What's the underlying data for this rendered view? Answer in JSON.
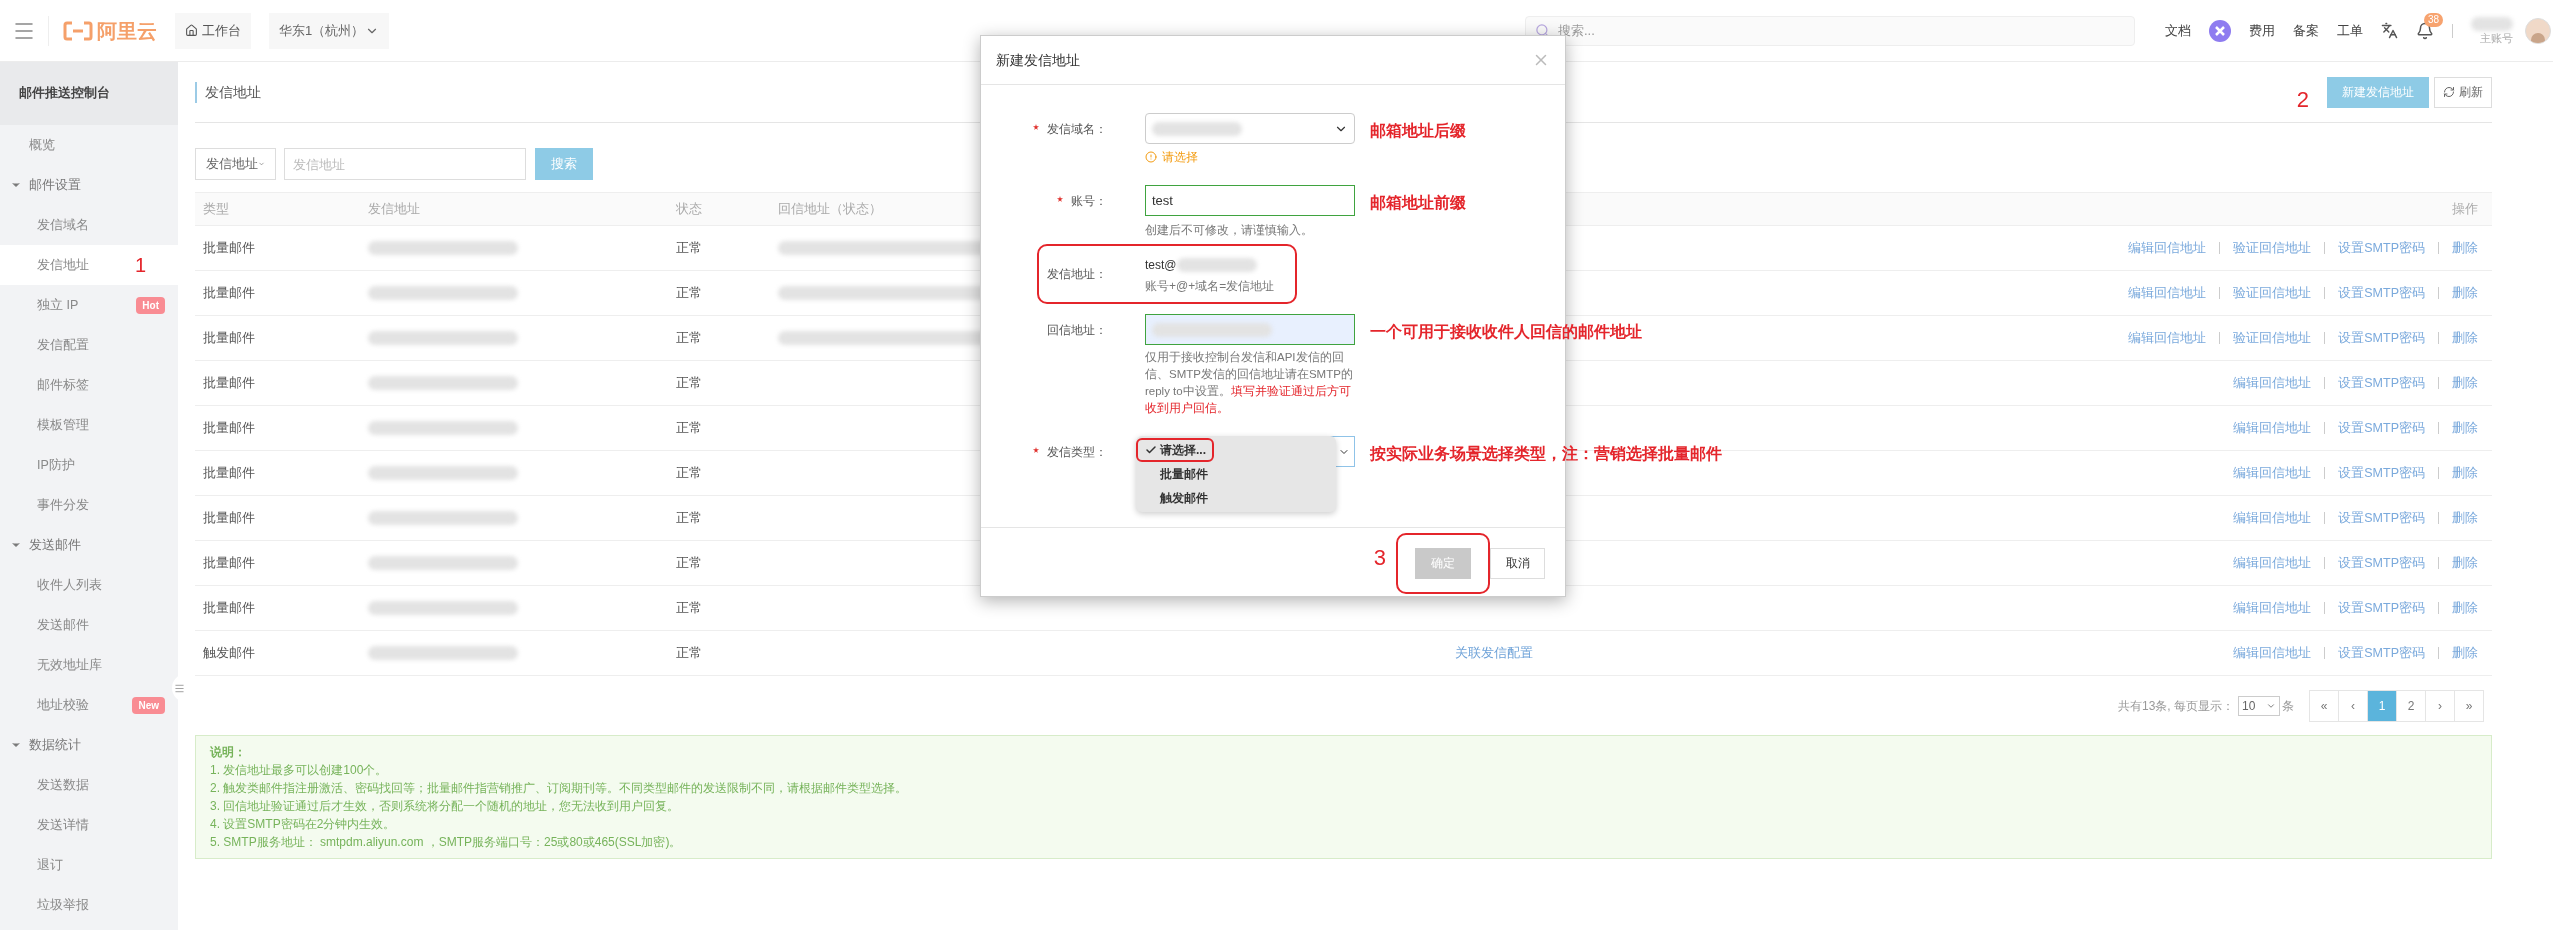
{
  "topbar": {
    "logo_text": "阿里云",
    "workbench": "工作台",
    "region": "华东1（杭州）",
    "search": {
      "placeholder": "搜索..."
    },
    "docs": "文档",
    "links": [
      "费用",
      "备案",
      "工单"
    ],
    "notification_count": "38",
    "account_label": "主账号"
  },
  "sidebar": {
    "title": "邮件推送控制台",
    "items": [
      {
        "label": "概览",
        "selected": false
      },
      {
        "label": "邮件设置",
        "expanded": true,
        "children": [
          {
            "label": "发信域名",
            "selected": false
          },
          {
            "label": "发信地址",
            "selected": true,
            "step": "1"
          },
          {
            "label": "独立 IP",
            "selected": false,
            "badge": "Hot"
          },
          {
            "label": "发信配置",
            "selected": false
          },
          {
            "label": "邮件标签",
            "selected": false
          },
          {
            "label": "模板管理",
            "selected": false
          },
          {
            "label": "IP防护",
            "selected": false
          },
          {
            "label": "事件分发",
            "selected": false
          }
        ]
      },
      {
        "label": "发送邮件",
        "expanded": true,
        "children": [
          {
            "label": "收件人列表",
            "selected": false
          },
          {
            "label": "发送邮件",
            "selected": false
          },
          {
            "label": "无效地址库",
            "selected": false
          },
          {
            "label": "地址校验",
            "selected": false,
            "badge": "New"
          }
        ]
      },
      {
        "label": "数据统计",
        "expanded": true,
        "children": [
          {
            "label": "发送数据",
            "selected": false
          },
          {
            "label": "发送详情",
            "selected": false
          },
          {
            "label": "退订",
            "selected": false
          },
          {
            "label": "垃圾举报",
            "selected": false
          }
        ]
      }
    ]
  },
  "page": {
    "title": "发信地址",
    "new_button": {
      "label": "新建发信地址",
      "step": "2"
    },
    "refresh_button": "刷新"
  },
  "filter": {
    "field_select": "发信地址",
    "input_placeholder": "发信地址",
    "search_button": "搜索"
  },
  "table": {
    "columns": [
      "类型",
      "发信地址",
      "状态",
      "回信地址（状态）"
    ],
    "action_column": "操作",
    "rows": [
      {
        "type": "批量邮件",
        "status": "正常",
        "reply_redacted": true,
        "actions": [
          "编辑回信地址",
          "验证回信地址",
          "设置SMTP密码",
          "删除"
        ]
      },
      {
        "type": "批量邮件",
        "status": "正常",
        "reply_redacted": true,
        "actions": [
          "编辑回信地址",
          "验证回信地址",
          "设置SMTP密码",
          "删除"
        ]
      },
      {
        "type": "批量邮件",
        "status": "正常",
        "reply_redacted": true,
        "actions": [
          "编辑回信地址",
          "验证回信地址",
          "设置SMTP密码",
          "删除"
        ]
      },
      {
        "type": "批量邮件",
        "status": "正常",
        "reply_redacted": false,
        "actions": [
          "编辑回信地址",
          "设置SMTP密码",
          "删除"
        ]
      },
      {
        "type": "批量邮件",
        "status": "正常",
        "reply_redacted": false,
        "actions": [
          "编辑回信地址",
          "设置SMTP密码",
          "删除"
        ]
      },
      {
        "type": "批量邮件",
        "status": "正常",
        "reply_redacted": false,
        "actions": [
          "编辑回信地址",
          "设置SMTP密码",
          "删除"
        ]
      },
      {
        "type": "批量邮件",
        "status": "正常",
        "reply_redacted": false,
        "actions": [
          "编辑回信地址",
          "设置SMTP密码",
          "删除"
        ]
      },
      {
        "type": "批量邮件",
        "status": "正常",
        "reply_redacted": false,
        "actions": [
          "编辑回信地址",
          "设置SMTP密码",
          "删除"
        ]
      },
      {
        "type": "批量邮件",
        "status": "正常",
        "reply_redacted": false,
        "actions": [
          "编辑回信地址",
          "设置SMTP密码",
          "删除"
        ]
      },
      {
        "type": "触发邮件",
        "status": "正常",
        "reply_redacted": false,
        "link": "关联发信配置",
        "actions": [
          "编辑回信地址",
          "设置SMTP密码",
          "删除"
        ]
      }
    ]
  },
  "pagination": {
    "summary": "共有13条, 每页显示：",
    "page_size": "10",
    "unit": "条",
    "pages": [
      {
        "label": "«",
        "selected": false
      },
      {
        "label": "‹",
        "selected": false
      },
      {
        "label": "1",
        "selected": true
      },
      {
        "label": "2",
        "selected": false
      },
      {
        "label": "›",
        "selected": false
      },
      {
        "label": "»",
        "selected": false
      }
    ]
  },
  "notes": {
    "title": "说明：",
    "lines": [
      "1. 发信地址最多可以创建100个。",
      "2. 触发类邮件指注册激活、密码找回等；批量邮件指营销推广、订阅期刊等。不同类型邮件的发送限制不同，请根据邮件类型选择。",
      "3. 回信地址验证通过后才生效，否则系统将分配一个随机的地址，您无法收到用户回复。",
      "4. 设置SMTP密码在2分钟内生效。",
      "5. SMTP服务地址： smtpdm.aliyun.com ，SMTP服务端口号：25或80或465(SSL加密)。"
    ]
  },
  "modal": {
    "title": "新建发信地址",
    "fields": [
      {
        "kind": "select",
        "label": "发信域名：",
        "required": true,
        "warning": "请选择",
        "note": "邮箱地址后缀"
      },
      {
        "kind": "input",
        "label": "账号：",
        "required": true,
        "value": "test",
        "valid": true,
        "hint": "创建后不可修改，请谨慎输入。",
        "note": "邮箱地址前缀"
      },
      {
        "kind": "display",
        "label": "发信地址：",
        "required": false,
        "value": "test@",
        "hint": "账号+@+域名=发信地址",
        "highlighted": true
      },
      {
        "kind": "reply",
        "label": "回信地址：",
        "required": false,
        "valid": true,
        "hint": "仅用于接收控制台发信和API发信的回信、SMTP发信的回信地址请在SMTP的reply to中设置。",
        "hint_warning": "填写并验证通过后方可收到用户回信。",
        "note": "一个可用于接收收件人回信的邮件地址"
      },
      {
        "kind": "dropdown",
        "label": "发信类型：",
        "required": true,
        "note": "按实际业务场景选择类型，注：营销选择批量邮件",
        "options": [
          {
            "label": "请选择...",
            "selected": true,
            "highlighted": true
          },
          {
            "label": "批量邮件",
            "selected": false,
            "highlighted": false
          },
          {
            "label": "触发邮件",
            "selected": false,
            "highlighted": false
          }
        ]
      }
    ],
    "confirm": {
      "label": "确定",
      "disabled": true,
      "highlighted": true,
      "step": "3"
    },
    "cancel": "取消"
  }
}
